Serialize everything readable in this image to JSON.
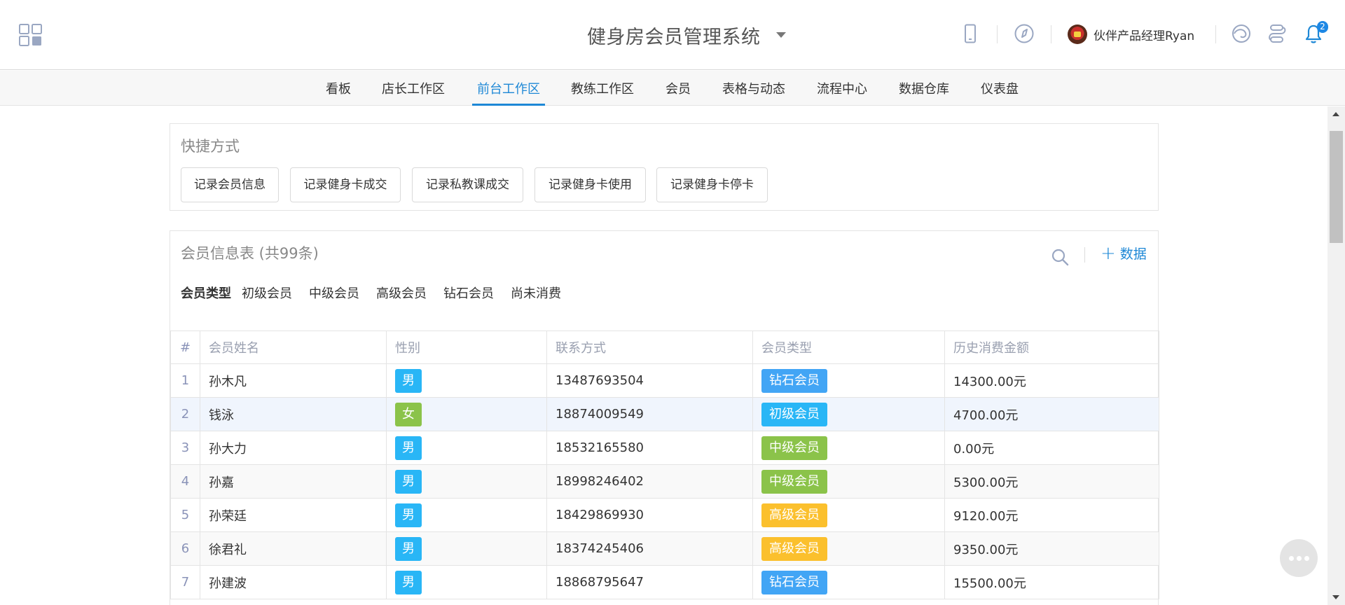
{
  "header": {
    "app_title": "健身房会员管理系统",
    "user_name": "伙伴产品经理Ryan",
    "notification_count": "2"
  },
  "nav": {
    "tabs": [
      {
        "label": "看板"
      },
      {
        "label": "店长工作区"
      },
      {
        "label": "前台工作区",
        "active": true
      },
      {
        "label": "教练工作区"
      },
      {
        "label": "会员"
      },
      {
        "label": "表格与动态"
      },
      {
        "label": "流程中心"
      },
      {
        "label": "数据仓库"
      },
      {
        "label": "仪表盘"
      }
    ]
  },
  "shortcuts": {
    "title": "快捷方式",
    "buttons": [
      "记录会员信息",
      "记录健身卡成交",
      "记录私教课成交",
      "记录健身卡使用",
      "记录健身卡停卡"
    ]
  },
  "member_table": {
    "title": "会员信息表 (共99条)",
    "add_label": "数据",
    "filter_label": "会员类型",
    "filter_options": [
      "初级会员",
      "中级会员",
      "高级会员",
      "钻石会员",
      "尚未消费"
    ],
    "columns": [
      "#",
      "会员姓名",
      "性别",
      "联系方式",
      "会员类型",
      "历史消费金额"
    ],
    "rows": [
      {
        "idx": "1",
        "name": "孙木凡",
        "gender": "男",
        "phone": "13487693504",
        "type": "钻石会员",
        "amount": "14300.00元"
      },
      {
        "idx": "2",
        "name": "钱泳",
        "gender": "女",
        "phone": "18874009549",
        "type": "初级会员",
        "amount": "4700.00元"
      },
      {
        "idx": "3",
        "name": "孙大力",
        "gender": "男",
        "phone": "18532165580",
        "type": "中级会员",
        "amount": "0.00元"
      },
      {
        "idx": "4",
        "name": "孙嘉",
        "gender": "男",
        "phone": "18998246402",
        "type": "中级会员",
        "amount": "5300.00元"
      },
      {
        "idx": "5",
        "name": "孙荣廷",
        "gender": "男",
        "phone": "18429869930",
        "type": "高级会员",
        "amount": "9120.00元"
      },
      {
        "idx": "6",
        "name": "徐君礼",
        "gender": "男",
        "phone": "18374245406",
        "type": "高级会员",
        "amount": "9350.00元"
      },
      {
        "idx": "7",
        "name": "孙建波",
        "gender": "男",
        "phone": "18868795647",
        "type": "钻石会员",
        "amount": "15500.00元"
      }
    ]
  },
  "colors": {
    "accent": "#1e88d6",
    "male": "#29b6f6",
    "female": "#8bc34a",
    "type_diamond": "#42a5f5",
    "type_junior": "#29b6f6",
    "type_middle": "#8bc34a",
    "type_senior": "#fbc02d"
  }
}
